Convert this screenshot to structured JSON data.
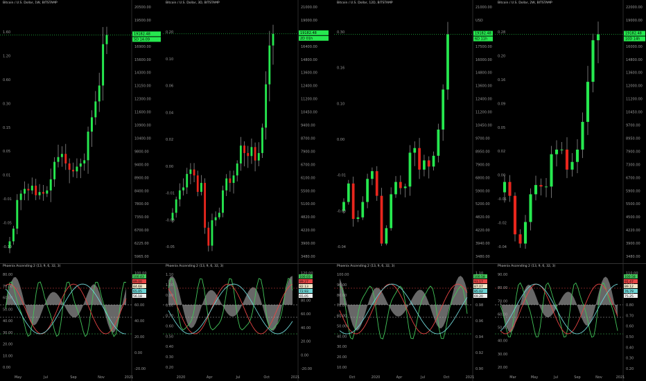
{
  "colors": {
    "bg": "#000000",
    "up": "#26e84f",
    "down": "#e8261d",
    "grid": "#1c1c1c",
    "axis": "#9a9a9a",
    "current": "#26e84f",
    "osc_grey": "#8a8a8a",
    "osc_red": "#e84545",
    "osc_cyan": "#6fd6d6",
    "osc_green": "#43c65a"
  },
  "panels": [
    {
      "title": "Bitcoin / U.S. Dollar, 1W, BITSTAMP",
      "osc_title": "Phoenix Ascending 2 (13, 9, 6, 32, 3)",
      "price_right": [
        "20500.00",
        "19500.00",
        "18000.00",
        "16900.00",
        "15600.00",
        "14300.00",
        "13150.00",
        "12300.00",
        "11600.00",
        "10900.00",
        "10400.00",
        "9800.00",
        "9400.00",
        "8900.00",
        "8400.00",
        "7800.00",
        "7350.00",
        "6700.00",
        "6225.00",
        "5965.00"
      ],
      "price_left": [
        "1.60",
        "1.20",
        "0.60",
        "0.30",
        "0.15",
        "0.05",
        "0.01",
        "-0.01",
        "-0.05",
        "-0.10"
      ],
      "price_badge": "19182.48",
      "time_badge": "5D 14:09",
      "osc_right": [
        "100.00",
        "80.00",
        "60.00",
        "40.00",
        "20.00",
        "0.00",
        "-20.00"
      ],
      "osc_left": [
        "80.00",
        "70.00",
        "60.00",
        "50.00",
        "40.00",
        "30.00",
        "20.00",
        "10.00",
        "0.00"
      ],
      "osc_badges": [
        "100.43",
        "89.00",
        "84.68",
        "65.05",
        "56.18"
      ],
      "x_labels": [
        "May",
        "Jul",
        "Sep",
        "Nov",
        "2021"
      ]
    },
    {
      "title": "Bitcoin / U.S. Dollar, 3D, BITSTAMP",
      "osc_title": "Phoenix Ascending 2 (13, 9, 6, 32, 3)",
      "price_right": [
        "21000.00",
        "19000.00",
        "17000.00",
        "16400.00",
        "14800.00",
        "13600.00",
        "12400.00",
        "11200.00",
        "10450.00",
        "9400.00",
        "8700.00",
        "7900.00",
        "6700.00",
        "6100.00",
        "5500.00",
        "5100.00",
        "4820.00",
        "4220.00",
        "3900.00",
        "3480.00"
      ],
      "price_left": [
        "0.20",
        "0.10",
        "0.06",
        "0.04",
        "0.02",
        "0.00",
        "-0.01",
        "-0.03",
        "-0.05"
      ],
      "price_badge": "19182.48",
      "time_badge": "2D 01h",
      "osc_right": [
        "120.00",
        "100.00",
        "80.00",
        "60.00",
        "40.00",
        "20.00",
        "0.00",
        "-20.00"
      ],
      "osc_left": [
        "1.10",
        "1.00",
        "0.90",
        "0.80",
        "0.70",
        "0.60",
        "0.50",
        "0.40",
        "0.30",
        "0.20"
      ],
      "osc_badges": [
        "100.03",
        "89.27",
        "82.13",
        "72.93",
        "65.05"
      ],
      "x_labels": [
        "2020",
        "Apr",
        "Jul",
        "Oct",
        "2021"
      ]
    },
    {
      "title": "Bitcoin / U.S. Dollar, 12D, BITSTAMP",
      "osc_title": "Phoenix Ascending 2 (13, 9, 6, 32, 3)",
      "price_right": [
        "21000.00",
        "USD",
        "19000.00",
        "17500.00",
        "16000.00",
        "14800.00",
        "13600.00",
        "12400.00",
        "11200.00",
        "10450.00",
        "9700.00",
        "8950.00",
        "7900.00",
        "6800.00",
        "5900.00",
        "5200.00",
        "4820.00",
        "4220.00",
        "3940.00",
        "3480.00"
      ],
      "price_left": [
        "0.30",
        "0.16",
        "0.10",
        "0.00",
        "-0.01",
        "-0.03",
        "-0.04"
      ],
      "price_badge": "19182.48",
      "time_badge": "6D 11h",
      "osc_right": [
        "1.10",
        "1.00",
        "0.98",
        "0.96",
        "0.94",
        "0.92",
        "0.90"
      ],
      "osc_left": [
        "100.00",
        "90.00",
        "80.00",
        "70.00",
        "60.00",
        "50.00",
        "40.00",
        "30.00",
        "20.00",
        "10.00"
      ],
      "osc_badges": [
        "100.58",
        "93.17",
        "87.07",
        "85.02",
        "69.20"
      ],
      "x_labels": [
        "Oct",
        "2020",
        "Apr",
        "Jul",
        "Oct",
        "2021"
      ]
    },
    {
      "title": "Bitcoin / U.S. Dollar, 2W, BITSTAMP",
      "osc_title": "Phoenix Ascending 2 (13, 9, 6, 32, 3)",
      "price_right": [
        "22000.00",
        "19000.00",
        "17000.00",
        "16000.00",
        "14800.00",
        "13600.00",
        "12000.00",
        "11200.00",
        "10450.00",
        "9700.00",
        "8950.00",
        "7900.00",
        "7300.00",
        "6700.00",
        "5900.00",
        "5500.00",
        "4500.00",
        "4220.00",
        "3900.00",
        "3480.00"
      ],
      "price_left": [
        "0.28",
        "0.20",
        "0.16",
        "0.09",
        "0.05",
        "0.02",
        "0.00",
        "-0.01",
        "-0.02",
        "-0.04"
      ],
      "price_badge": "19182.48",
      "time_badge": "10D 14h",
      "osc_right": [
        "110.00",
        "1.00",
        "0.90",
        "0.80",
        "0.70",
        "0.60",
        "0.50",
        "0.40",
        "0.30",
        "0.20"
      ],
      "osc_left": [
        "90.00",
        "80.00",
        "70.00",
        "60.00",
        "50.00",
        "40.00",
        "30.00",
        "20.00"
      ],
      "osc_badges": [
        "100.58",
        "91.47",
        "89.12",
        "76.79",
        "75.25"
      ],
      "x_labels": [
        "Mar",
        "May",
        "Jul",
        "Sep",
        "Nov",
        "2021"
      ]
    }
  ],
  "chart_data": [
    {
      "type": "candlestick",
      "title": "Bitcoin / U.S. Dollar, 1W, BITSTAMP",
      "last": 19182.48,
      "close": [
        6200,
        7000,
        8800,
        9200,
        9500,
        9400,
        9700,
        9100,
        9300,
        9200,
        9400,
        10100,
        11200,
        11500,
        11700,
        11100,
        10700,
        10600,
        10900,
        11100,
        11300,
        13100,
        14000,
        15000,
        16000,
        18600,
        19182
      ]
    },
    {
      "type": "candlestick",
      "title": "Bitcoin / U.S. Dollar, 3D, BITSTAMP",
      "last": 19182.48,
      "close": [
        7200,
        8100,
        8700,
        8900,
        9800,
        10100,
        9700,
        8600,
        9200,
        6200,
        5000,
        6700,
        6900,
        7200,
        8700,
        9500,
        9200,
        9700,
        10500,
        11700,
        11200,
        11000,
        11600,
        10700,
        11200,
        12900,
        15800,
        18400,
        19182
      ]
    },
    {
      "type": "candlestick",
      "title": "Bitcoin / U.S. Dollar, 12D, BITSTAMP",
      "last": 19182.48,
      "close": [
        8300,
        9500,
        7200,
        7300,
        8300,
        9800,
        10300,
        8700,
        5600,
        6600,
        8800,
        9600,
        9200,
        9300,
        11500,
        11800,
        10400,
        11000,
        10600,
        11300,
        13000,
        15600,
        19182
      ]
    },
    {
      "type": "candlestick",
      "title": "Bitcoin / U.S. Dollar, 2W, BITSTAMP",
      "last": 19182.48,
      "close": [
        9600,
        8700,
        6200,
        5600,
        7000,
        8800,
        9400,
        9300,
        9300,
        11400,
        11700,
        11700,
        10400,
        10900,
        11700,
        13500,
        16100,
        18800,
        19182
      ]
    }
  ]
}
